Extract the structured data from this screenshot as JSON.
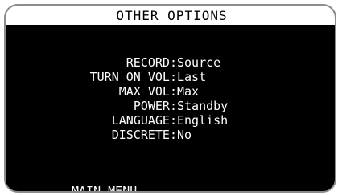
{
  "screen": {
    "title": "OTHER OPTIONS",
    "colors": {
      "background": "#000000",
      "text": "#ffffff",
      "title_bar": "#ffffff",
      "title_text": "#000000",
      "frame": "#8c8c8c"
    }
  },
  "options": [
    {
      "label": "RECORD:",
      "value": "Source"
    },
    {
      "label": "TURN ON VOL:",
      "value": "Last"
    },
    {
      "label": "MAX VOL:",
      "value": "Max"
    },
    {
      "label": "POWER:",
      "value": "Standby"
    },
    {
      "label": "LANGUAGE:",
      "value": "English"
    },
    {
      "label": "DISCRETE:",
      "value": "No"
    }
  ],
  "footer": {
    "main_menu": "MAIN MENU"
  }
}
